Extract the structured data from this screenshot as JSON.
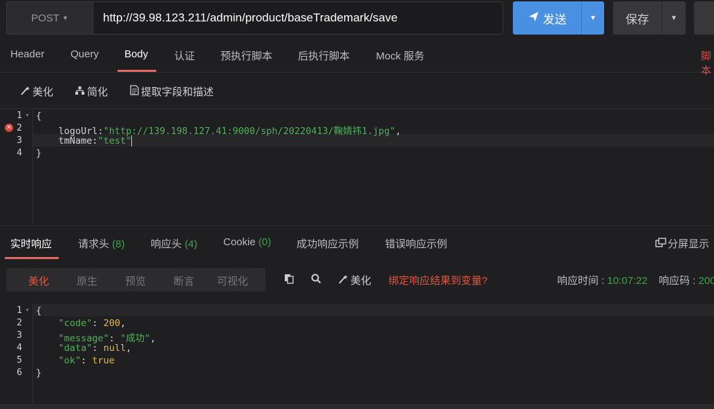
{
  "request": {
    "method": "POST",
    "url": "http://39.98.123.211/admin/product/baseTrademark/save",
    "send_label": "发送",
    "save_label": "保存"
  },
  "tabs": [
    {
      "label": "Header"
    },
    {
      "label": "Query"
    },
    {
      "label": "Body"
    },
    {
      "label": "认证"
    },
    {
      "label": "预执行脚本"
    },
    {
      "label": "后执行脚本"
    },
    {
      "label": "Mock 服务"
    }
  ],
  "tab_right_label": "脚本",
  "body_toolbar": {
    "beautify": "美化",
    "simplify": "简化",
    "extract": "提取字段和描述"
  },
  "request_body": {
    "line_numbers": [
      "1",
      "2",
      "3",
      "4"
    ],
    "open": "{",
    "key1": "logoUrl",
    "val1": "\"http://139.198.127.41:9000/sph/20220413/鞠婧祎1.jpg\"",
    "key2": "tmName",
    "val2": "\"test\"",
    "close": "}"
  },
  "response_tabs": {
    "realtime": "实时响应",
    "req_headers": "请求头",
    "req_headers_count": "(8)",
    "resp_headers": "响应头",
    "resp_headers_count": "(4)",
    "cookie": "Cookie",
    "cookie_count": "(0)",
    "success_example": "成功响应示例",
    "error_example": "错误响应示例",
    "split_view": "分屏显示"
  },
  "response_toolbar": {
    "segments": [
      "美化",
      "原生",
      "预览",
      "断言",
      "可视化"
    ],
    "beautify": "美化",
    "bind_link": "绑定响应结果到变量?",
    "time_label": "响应时间 : ",
    "time_value": "10:07:22",
    "code_label": "响应码 : ",
    "code_value": "200"
  },
  "response_body": {
    "line_numbers": [
      "1",
      "2",
      "3",
      "4",
      "5",
      "6"
    ],
    "open": "{",
    "k1": "\"code\"",
    "v1": "200",
    "k2": "\"message\"",
    "v2": "\"成功\"",
    "k3": "\"data\"",
    "v3": "null",
    "k4": "\"ok\"",
    "v4": "true",
    "close": "}"
  },
  "colors": {
    "accent_blue": "#4a90e2",
    "accent_red": "#e36a62",
    "string_green": "#4fb35a",
    "number_yellow": "#e5b842"
  }
}
